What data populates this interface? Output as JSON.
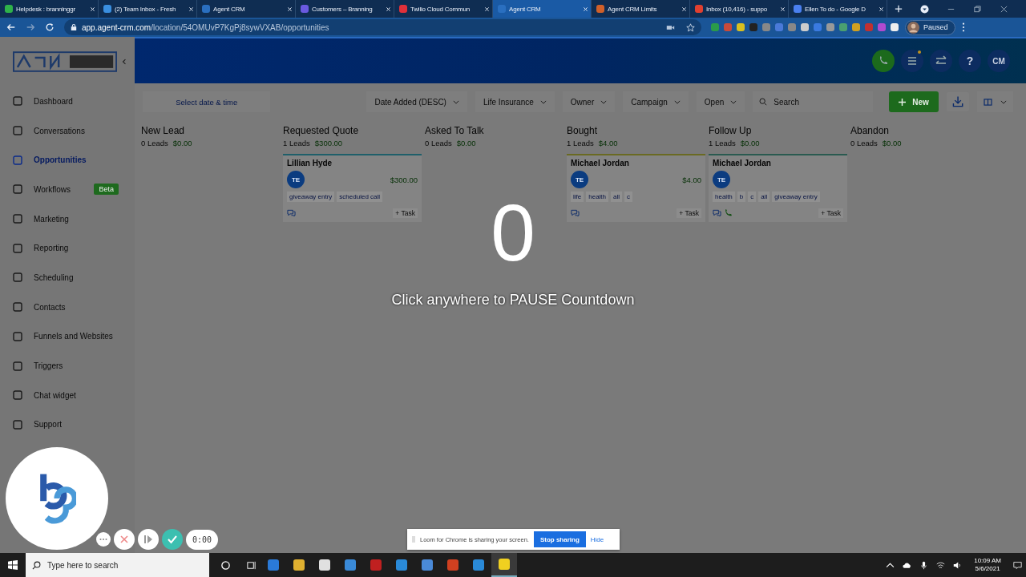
{
  "browser": {
    "tabs": [
      {
        "title": "Helpdesk : branninggr",
        "selected": false,
        "color": "#2fb24a"
      },
      {
        "title": "(2) Team Inbox - Fresh",
        "selected": false,
        "color": "#3a8fe0"
      },
      {
        "title": "Agent CRM",
        "selected": false,
        "color": "#2a6fc0"
      },
      {
        "title": "Customers – Branning",
        "selected": false,
        "color": "#6a5ae0"
      },
      {
        "title": "Twilio Cloud Commun",
        "selected": false,
        "color": "#e0303a"
      },
      {
        "title": "Agent CRM",
        "selected": true,
        "color": "#2a6fc0"
      },
      {
        "title": "Agent CRM Limits",
        "selected": false,
        "color": "#d0602a"
      },
      {
        "title": "Inbox (10,416) - suppo",
        "selected": false,
        "color": "#e04030"
      },
      {
        "title": "Ellen To do - Google D",
        "selected": false,
        "color": "#4a80f0"
      }
    ],
    "url_host": "app.agent-crm.com",
    "url_path": "/location/54OMUvP7KgPj8sywVXAB/opportunities",
    "profile": "Paused"
  },
  "sidebar": {
    "items": [
      {
        "label": "Dashboard",
        "selected": false
      },
      {
        "label": "Conversations",
        "selected": false
      },
      {
        "label": "Opportunities",
        "selected": true
      },
      {
        "label": "Workflows",
        "selected": false,
        "badge": "Beta"
      },
      {
        "label": "Marketing",
        "selected": false
      },
      {
        "label": "Reporting",
        "selected": false
      },
      {
        "label": "Scheduling",
        "selected": false
      },
      {
        "label": "Contacts",
        "selected": false
      },
      {
        "label": "Funnels and Websites",
        "selected": false
      },
      {
        "label": "Triggers",
        "selected": false
      },
      {
        "label": "Chat widget",
        "selected": false
      },
      {
        "label": "Support",
        "selected": false
      }
    ]
  },
  "header": {
    "help": "?",
    "avatar": "CM"
  },
  "toolbar": {
    "date_placeholder": "Select date & time",
    "filters": [
      "Date Added (DESC)",
      "Life Insurance",
      "Owner",
      "Campaign",
      "Open"
    ],
    "search_placeholder": "Search",
    "new_button": "New"
  },
  "columns": [
    {
      "name": "New Lead",
      "count": "0 Leads",
      "value": "$0.00"
    },
    {
      "name": "Requested Quote",
      "count": "1 Leads",
      "value": "$300.00",
      "cards": [
        {
          "name": "Lillian Hyde",
          "avatar": "TE",
          "amount": "$300.00",
          "color": "#1f5f6a",
          "tags": [
            "giveaway entry",
            "scheduled call"
          ],
          "phone": false,
          "task": "+ Task"
        }
      ]
    },
    {
      "name": "Asked To Talk",
      "count": "0 Leads",
      "value": "$0.00"
    },
    {
      "name": "Bought",
      "count": "1 Leads",
      "value": "$4.00",
      "cards": [
        {
          "name": "Michael Jordan",
          "avatar": "TE",
          "amount": "$4.00",
          "color": "#6a6a22",
          "tags": [
            "life",
            "health",
            "all",
            "c"
          ],
          "phone": false,
          "task": "+ Task"
        }
      ]
    },
    {
      "name": "Follow Up",
      "count": "1 Leads",
      "value": "$0.00",
      "cards": [
        {
          "name": "Michael Jordan",
          "avatar": "TE",
          "color": "#2a5a50",
          "tags": [
            "health",
            "b",
            "c",
            "all",
            "giveaway entry"
          ],
          "phone": true,
          "task": "+ Task"
        }
      ]
    },
    {
      "name": "Abandon",
      "count": "0 Leads",
      "value": "$0.00"
    }
  ],
  "countdown": {
    "number": "0",
    "message": "Click anywhere to PAUSE Countdown"
  },
  "recorder": {
    "time": "0:00"
  },
  "share_banner": {
    "message": "Loom for Chrome is sharing your screen.",
    "stop": "Stop sharing",
    "hide": "Hide"
  },
  "taskbar": {
    "search_placeholder": "Type here to search",
    "time": "10:09 AM",
    "date": "5/6/2021"
  }
}
